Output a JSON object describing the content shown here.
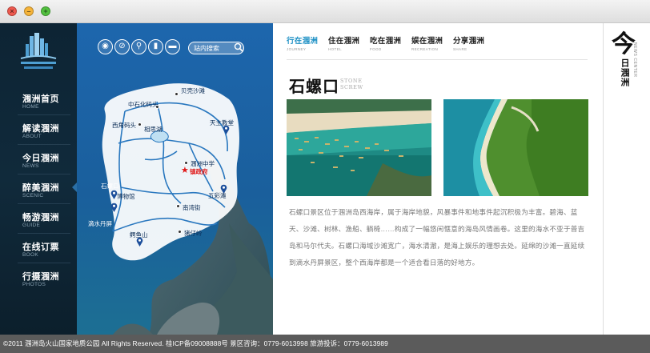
{
  "window": {
    "close": "×",
    "min": "–",
    "max": "+"
  },
  "logo": {
    "cn": "涠洲岛"
  },
  "nav": [
    {
      "cn": "涠洲首页",
      "en": "HOME"
    },
    {
      "cn": "解读涠洲",
      "en": "ABOUT"
    },
    {
      "cn": "今日涠洲",
      "en": "NEWS"
    },
    {
      "cn": "醉美涠洲",
      "en": "SCENIC"
    },
    {
      "cn": "畅游涠洲",
      "en": "GUIDE"
    },
    {
      "cn": "在线订票",
      "en": "BOOK"
    },
    {
      "cn": "行摄涠洲",
      "en": "PHOTOS"
    }
  ],
  "search": {
    "placeholder": "站内搜索"
  },
  "map": {
    "places": [
      "贝壳沙滩",
      "中石化码头",
      "西角码头",
      "滴水丹屏",
      "相思湖",
      "天主教堂",
      "涠洲中学",
      "镇政府",
      "石螺口",
      "博物馆",
      "五彩滩",
      "南湾街",
      "鳄鱼山",
      "猪仔岭"
    ]
  },
  "tabs": [
    {
      "cn": "行在涠洲",
      "en": "JOURNEY"
    },
    {
      "cn": "住在涠洲",
      "en": "HOTEL"
    },
    {
      "cn": "吃在涠洲",
      "en": "FOOD"
    },
    {
      "cn": "娱在涠洲",
      "en": "RECREATION"
    },
    {
      "cn": "分享涠洲",
      "en": "SHARE"
    }
  ],
  "article": {
    "title": "石螺口",
    "title_en_1": "STONE",
    "title_en_2": "SCREW",
    "body": "石螺口景区位于涠洲岛西海岸，属于海岸地貌，风暴事件和地事件起沉积极为丰富。碧海、蓝天、沙滩、树林、渔船、躺椅……构成了一幅悠闲惬意的海岛风情画卷。这里的海水不亚于普吉岛和马尔代夫。石螺口海域沙滩宽广，海水清澈，是海上娱乐的理想去处。延绵的沙滩一直延续到滴水丹屏景区，整个西海岸都是一个适合看日落的好地方。"
  },
  "right_panel": {
    "big": "今",
    "small": "日涠洲",
    "en": "NEWS CENTER"
  },
  "footer": {
    "text": "©2011 涠洲岛火山国家地质公园 All Rights Reserved. 桂ICP备09008888号 景区咨询：0779-6013998 旅游投诉：0779-6013989"
  },
  "colors": {
    "accent": "#1b8fc4",
    "sidebar": "#102a3b",
    "footer": "#5b5b5b"
  }
}
